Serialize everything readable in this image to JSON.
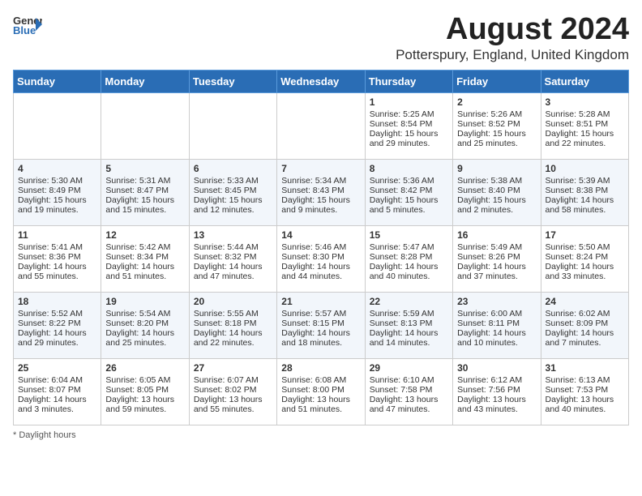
{
  "header": {
    "logo_general": "General",
    "logo_blue": "Blue",
    "month_year": "August 2024",
    "location": "Potterspury, England, United Kingdom"
  },
  "days_of_week": [
    "Sunday",
    "Monday",
    "Tuesday",
    "Wednesday",
    "Thursday",
    "Friday",
    "Saturday"
  ],
  "weeks": [
    [
      {
        "day": "",
        "info": ""
      },
      {
        "day": "",
        "info": ""
      },
      {
        "day": "",
        "info": ""
      },
      {
        "day": "",
        "info": ""
      },
      {
        "day": "1",
        "info": "Sunrise: 5:25 AM\nSunset: 8:54 PM\nDaylight: 15 hours and 29 minutes."
      },
      {
        "day": "2",
        "info": "Sunrise: 5:26 AM\nSunset: 8:52 PM\nDaylight: 15 hours and 25 minutes."
      },
      {
        "day": "3",
        "info": "Sunrise: 5:28 AM\nSunset: 8:51 PM\nDaylight: 15 hours and 22 minutes."
      }
    ],
    [
      {
        "day": "4",
        "info": "Sunrise: 5:30 AM\nSunset: 8:49 PM\nDaylight: 15 hours and 19 minutes."
      },
      {
        "day": "5",
        "info": "Sunrise: 5:31 AM\nSunset: 8:47 PM\nDaylight: 15 hours and 15 minutes."
      },
      {
        "day": "6",
        "info": "Sunrise: 5:33 AM\nSunset: 8:45 PM\nDaylight: 15 hours and 12 minutes."
      },
      {
        "day": "7",
        "info": "Sunrise: 5:34 AM\nSunset: 8:43 PM\nDaylight: 15 hours and 9 minutes."
      },
      {
        "day": "8",
        "info": "Sunrise: 5:36 AM\nSunset: 8:42 PM\nDaylight: 15 hours and 5 minutes."
      },
      {
        "day": "9",
        "info": "Sunrise: 5:38 AM\nSunset: 8:40 PM\nDaylight: 15 hours and 2 minutes."
      },
      {
        "day": "10",
        "info": "Sunrise: 5:39 AM\nSunset: 8:38 PM\nDaylight: 14 hours and 58 minutes."
      }
    ],
    [
      {
        "day": "11",
        "info": "Sunrise: 5:41 AM\nSunset: 8:36 PM\nDaylight: 14 hours and 55 minutes."
      },
      {
        "day": "12",
        "info": "Sunrise: 5:42 AM\nSunset: 8:34 PM\nDaylight: 14 hours and 51 minutes."
      },
      {
        "day": "13",
        "info": "Sunrise: 5:44 AM\nSunset: 8:32 PM\nDaylight: 14 hours and 47 minutes."
      },
      {
        "day": "14",
        "info": "Sunrise: 5:46 AM\nSunset: 8:30 PM\nDaylight: 14 hours and 44 minutes."
      },
      {
        "day": "15",
        "info": "Sunrise: 5:47 AM\nSunset: 8:28 PM\nDaylight: 14 hours and 40 minutes."
      },
      {
        "day": "16",
        "info": "Sunrise: 5:49 AM\nSunset: 8:26 PM\nDaylight: 14 hours and 37 minutes."
      },
      {
        "day": "17",
        "info": "Sunrise: 5:50 AM\nSunset: 8:24 PM\nDaylight: 14 hours and 33 minutes."
      }
    ],
    [
      {
        "day": "18",
        "info": "Sunrise: 5:52 AM\nSunset: 8:22 PM\nDaylight: 14 hours and 29 minutes."
      },
      {
        "day": "19",
        "info": "Sunrise: 5:54 AM\nSunset: 8:20 PM\nDaylight: 14 hours and 25 minutes."
      },
      {
        "day": "20",
        "info": "Sunrise: 5:55 AM\nSunset: 8:18 PM\nDaylight: 14 hours and 22 minutes."
      },
      {
        "day": "21",
        "info": "Sunrise: 5:57 AM\nSunset: 8:15 PM\nDaylight: 14 hours and 18 minutes."
      },
      {
        "day": "22",
        "info": "Sunrise: 5:59 AM\nSunset: 8:13 PM\nDaylight: 14 hours and 14 minutes."
      },
      {
        "day": "23",
        "info": "Sunrise: 6:00 AM\nSunset: 8:11 PM\nDaylight: 14 hours and 10 minutes."
      },
      {
        "day": "24",
        "info": "Sunrise: 6:02 AM\nSunset: 8:09 PM\nDaylight: 14 hours and 7 minutes."
      }
    ],
    [
      {
        "day": "25",
        "info": "Sunrise: 6:04 AM\nSunset: 8:07 PM\nDaylight: 14 hours and 3 minutes."
      },
      {
        "day": "26",
        "info": "Sunrise: 6:05 AM\nSunset: 8:05 PM\nDaylight: 13 hours and 59 minutes."
      },
      {
        "day": "27",
        "info": "Sunrise: 6:07 AM\nSunset: 8:02 PM\nDaylight: 13 hours and 55 minutes."
      },
      {
        "day": "28",
        "info": "Sunrise: 6:08 AM\nSunset: 8:00 PM\nDaylight: 13 hours and 51 minutes."
      },
      {
        "day": "29",
        "info": "Sunrise: 6:10 AM\nSunset: 7:58 PM\nDaylight: 13 hours and 47 minutes."
      },
      {
        "day": "30",
        "info": "Sunrise: 6:12 AM\nSunset: 7:56 PM\nDaylight: 13 hours and 43 minutes."
      },
      {
        "day": "31",
        "info": "Sunrise: 6:13 AM\nSunset: 7:53 PM\nDaylight: 13 hours and 40 minutes."
      }
    ]
  ],
  "footer": {
    "note": "Daylight hours"
  }
}
